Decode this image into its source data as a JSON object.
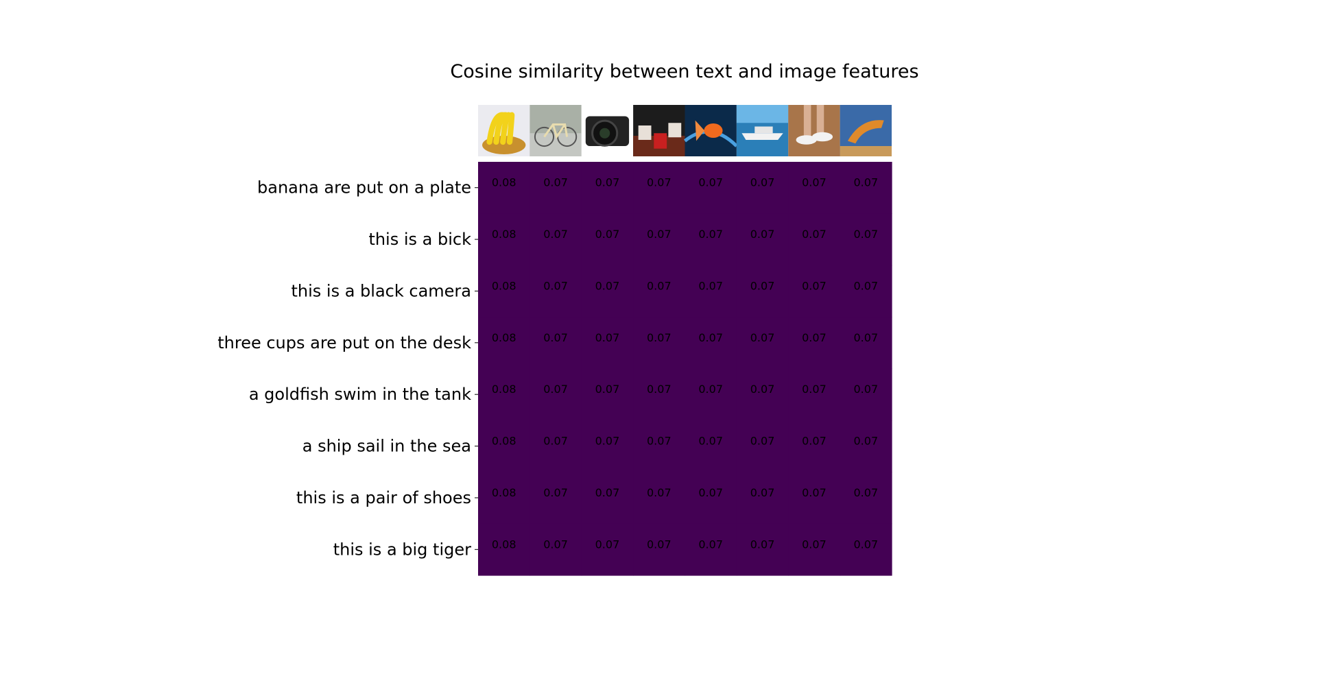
{
  "chart_data": {
    "type": "heatmap",
    "title": "Cosine similarity between text and image features",
    "rows": [
      "banana are put on a plate",
      "this is a bick",
      "this is a black camera",
      "three cups are put on the desk",
      "a goldfish swim in the tank",
      "a ship sail in the sea",
      "this is a pair of shoes",
      "this is a big tiger"
    ],
    "columns": [
      "banana",
      "bicycle",
      "camera",
      "cups",
      "goldfish",
      "ship",
      "shoes",
      "tiger"
    ],
    "values": [
      [
        0.08,
        0.07,
        0.07,
        0.07,
        0.07,
        0.07,
        0.07,
        0.07
      ],
      [
        0.08,
        0.07,
        0.07,
        0.07,
        0.07,
        0.07,
        0.07,
        0.07
      ],
      [
        0.08,
        0.07,
        0.07,
        0.07,
        0.07,
        0.07,
        0.07,
        0.07
      ],
      [
        0.08,
        0.07,
        0.07,
        0.07,
        0.07,
        0.07,
        0.07,
        0.07
      ],
      [
        0.08,
        0.07,
        0.07,
        0.07,
        0.07,
        0.07,
        0.07,
        0.07
      ],
      [
        0.08,
        0.07,
        0.07,
        0.07,
        0.07,
        0.07,
        0.07,
        0.07
      ],
      [
        0.08,
        0.07,
        0.07,
        0.07,
        0.07,
        0.07,
        0.07,
        0.07
      ],
      [
        0.08,
        0.07,
        0.07,
        0.07,
        0.07,
        0.07,
        0.07,
        0.07
      ]
    ],
    "colormap": "viridis",
    "vmin": 0.1,
    "vmax": 0.3,
    "cell_color": "#440154",
    "value_text_color": "#000000",
    "show_values": true,
    "xticks_visible": false
  },
  "images": [
    {
      "icon": "banana-photo-icon"
    },
    {
      "icon": "bicycle-photo-icon"
    },
    {
      "icon": "camera-photo-icon"
    },
    {
      "icon": "cups-photo-icon"
    },
    {
      "icon": "goldfish-photo-icon"
    },
    {
      "icon": "ship-photo-icon"
    },
    {
      "icon": "shoes-photo-icon"
    },
    {
      "icon": "tiger-photo-icon"
    }
  ]
}
